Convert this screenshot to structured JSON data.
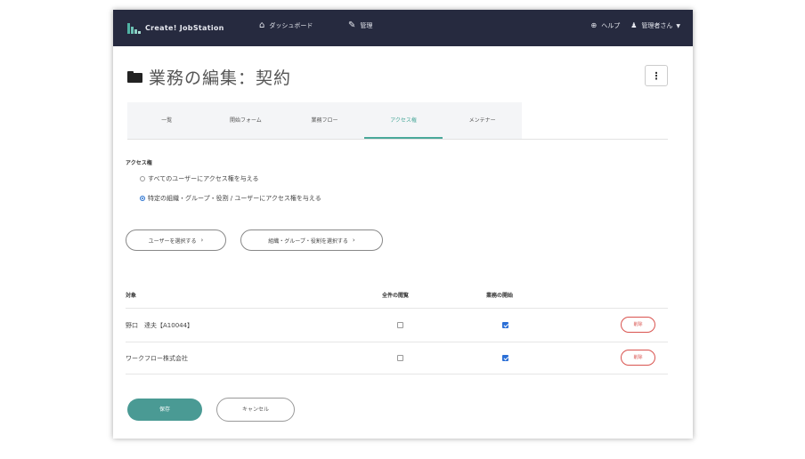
{
  "header": {
    "brand": "Create! JobStation",
    "nav_dashboard": "ダッシュボード",
    "nav_manage": "管理",
    "help": "ヘルプ",
    "user": "管理者さん"
  },
  "page": {
    "title": "業務の編集：契約"
  },
  "tabs": [
    {
      "label": "一覧"
    },
    {
      "label": "開始フォーム"
    },
    {
      "label": "業務フロー"
    },
    {
      "label": "アクセス権"
    },
    {
      "label": "メンテナー"
    }
  ],
  "access": {
    "section_label": "アクセス権",
    "option_all": "すべてのユーザーにアクセス権を与える",
    "option_specific": "特定の組織・グループ・役割 / ユーザーにアクセス権を与える",
    "selected": "specific",
    "select_users_button": "ユーザーを選択する",
    "select_orgs_button": "組織・グループ・役割を選択する"
  },
  "table": {
    "headers": {
      "target": "対象",
      "col_a": "全件の閲覧",
      "col_b": "業務の開始"
    },
    "rows": [
      {
        "name": "野口　達夫【A10044】",
        "view_all": false,
        "start": true,
        "delete_label": "削除"
      },
      {
        "name": "ワークフロー株式会社",
        "view_all": false,
        "start": true,
        "delete_label": "削除"
      }
    ]
  },
  "footer": {
    "save_label": "保存",
    "cancel_label": "キャンセル"
  }
}
